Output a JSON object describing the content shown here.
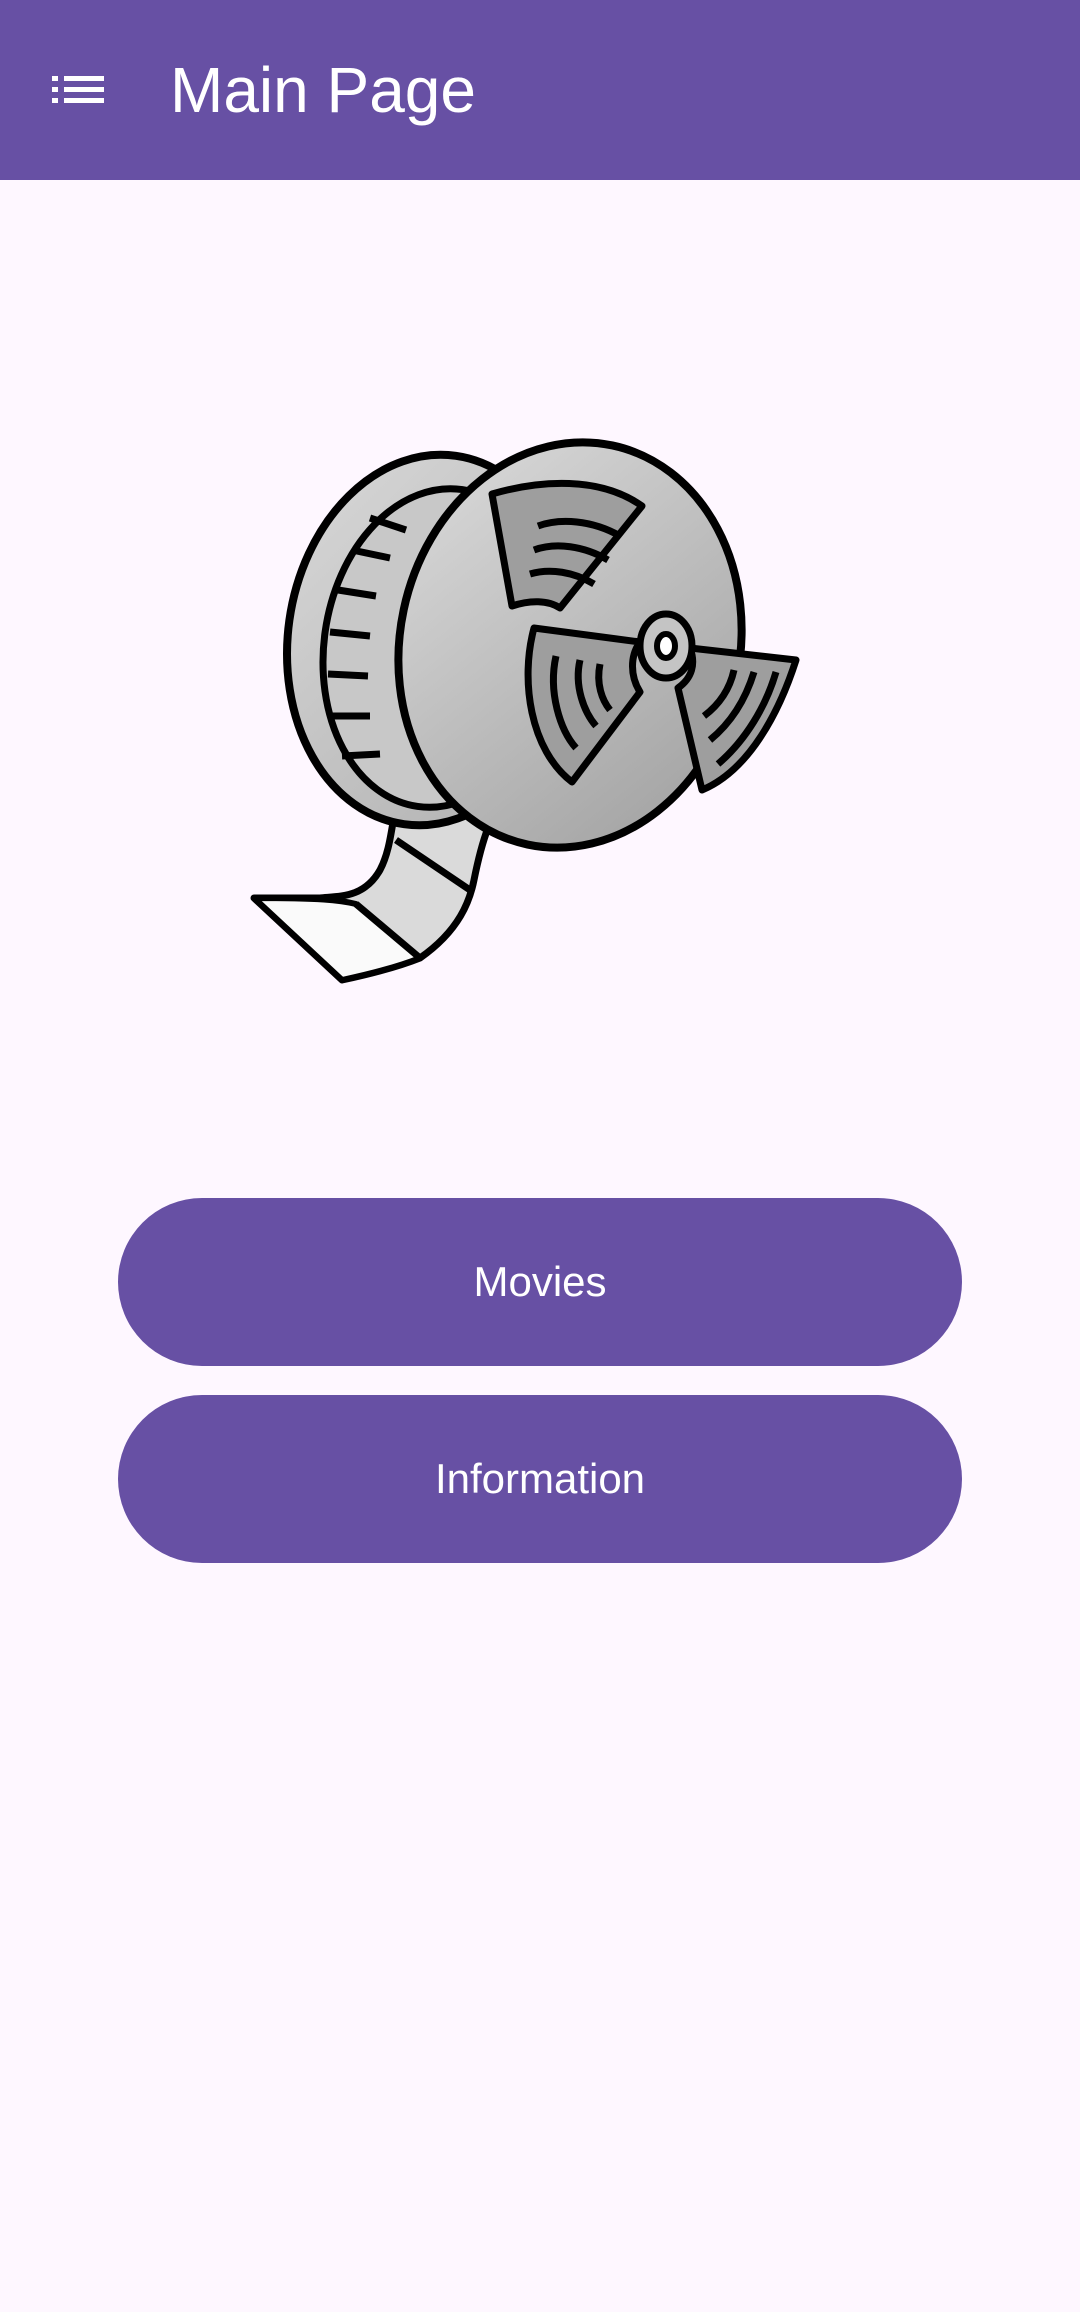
{
  "app_bar": {
    "title": "Main Page",
    "menu_icon": "list-icon",
    "background": "#6750A4"
  },
  "hero": {
    "icon": "film-reel-icon"
  },
  "buttons": {
    "movies_label": "Movies",
    "information_label": "Information"
  },
  "colors": {
    "primary": "#6750A4",
    "background": "#FEF7FF",
    "on_primary": "#FFFFFF"
  }
}
